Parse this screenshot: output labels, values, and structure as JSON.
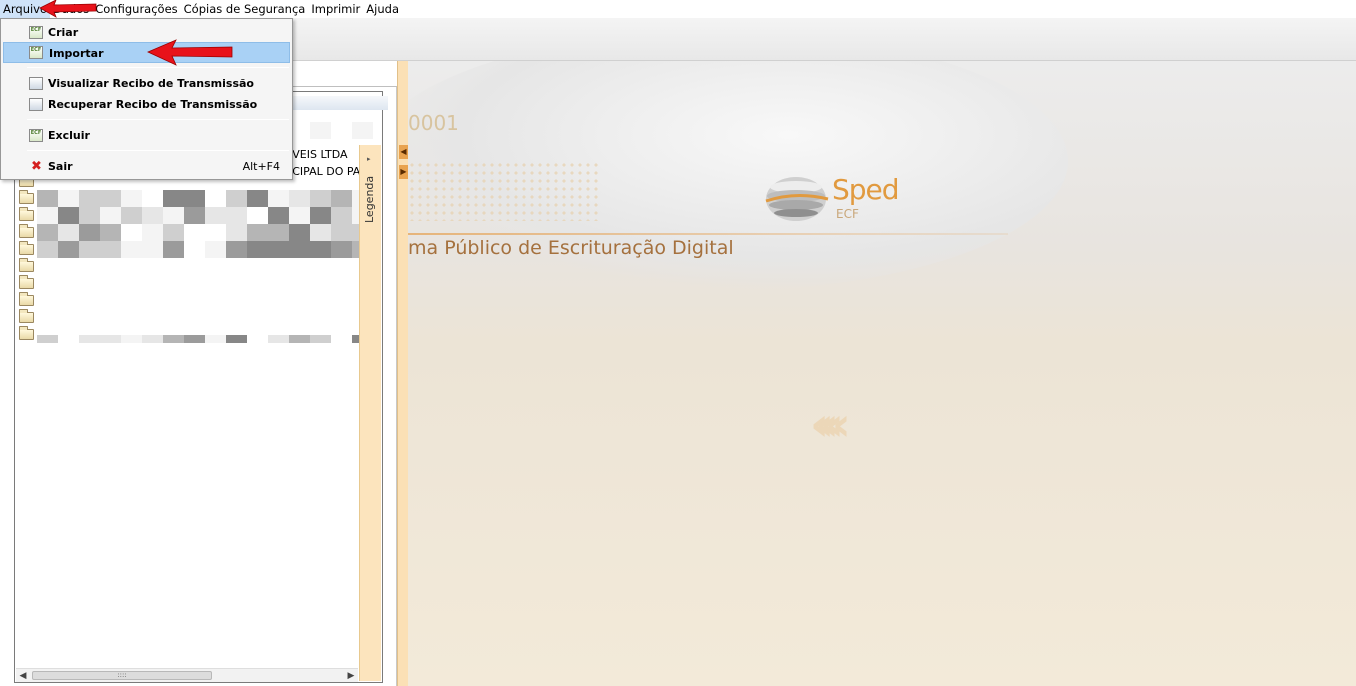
{
  "menubar": {
    "items": [
      "Arquivo",
      "Dados",
      "Configurações",
      "Cópias de Segurança",
      "Imprimir",
      "Ajuda"
    ],
    "active": "Arquivo"
  },
  "file_menu": {
    "items": [
      {
        "label": "Criar",
        "icon": "ecf-document-icon"
      },
      {
        "label": "Importar",
        "icon": "ecf-document-icon",
        "highlighted": true
      },
      {
        "label": "Visualizar Recibo de Transmissão",
        "icon": "receipt-icon"
      },
      {
        "label": "Recuperar Recibo de Transmissão",
        "icon": "receipt-icon"
      },
      {
        "label": "Excluir",
        "icon": "ecf-delete-icon"
      },
      {
        "label": "Sair",
        "icon": "close-x-icon",
        "shortcut": "Alt+F4"
      }
    ]
  },
  "tree": {
    "company_lines": [
      "IVEIS LTDA",
      "ICIPAL DO PA"
    ],
    "legend_label": "Legenda",
    "scroll_thumb_grip": "::::"
  },
  "banner": {
    "number_fragment": "0001",
    "logo_name": "Sped",
    "logo_sub": "ECF",
    "title": "ma Público de Escrituração Digital"
  },
  "colors": {
    "accent_orange": "#e19a3f",
    "menu_highlight": "#a9d1f5",
    "annotation_red": "#e8121a"
  }
}
